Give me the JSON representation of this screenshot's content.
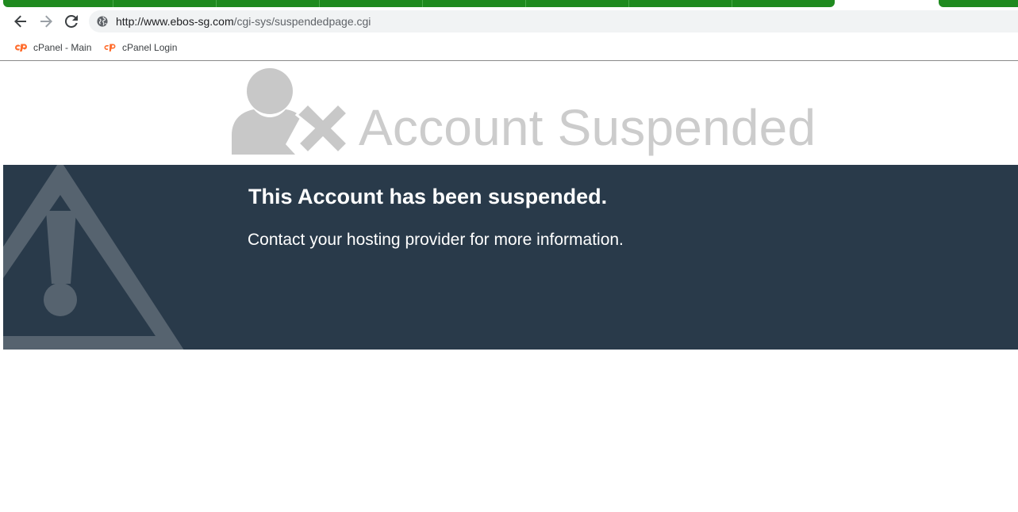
{
  "browser": {
    "address_bar": {
      "url_host": "http://www.ebos-sg.com",
      "url_path": "/cgi-sys/suspendedpage.cgi"
    },
    "nav_icons": [
      "back-icon",
      "forward-icon",
      "reload-icon",
      "site-info-icon"
    ],
    "bookmarks": [
      {
        "label": "cPanel - Main",
        "icon": "cpanel-icon"
      },
      {
        "label": "cPanel Login",
        "icon": "cpanel-icon"
      }
    ],
    "colors": {
      "tab_strip": "#1f8a1f",
      "omnibox": "#f1f3f4",
      "cpanel": "#ff6c2c"
    }
  },
  "page": {
    "hero_title": "Account Suspended",
    "hero_icon": "user-suspended-icon",
    "message_title": "This Account has been suspended.",
    "message_body": "Contact your hosting provider for more information.",
    "banner_icon": "warning-icon",
    "colors": {
      "banner": "#293a4a",
      "hero_text": "#cccccc",
      "warning_icon": "#56636f"
    }
  }
}
